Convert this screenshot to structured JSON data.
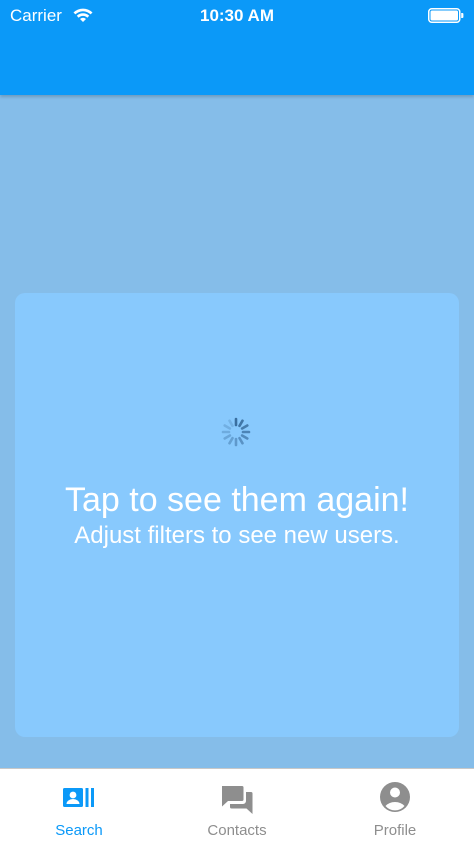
{
  "status_bar": {
    "carrier": "Carrier",
    "time": "10:30 AM",
    "wifi_icon": "wifi-icon",
    "battery_icon": "battery-icon"
  },
  "card": {
    "title": "Tap to see them again!",
    "subtitle": "Adjust filters to see new users.",
    "spinner_icon": "loading-spinner-icon"
  },
  "tabs": [
    {
      "label": "Search",
      "icon": "contact-card-icon",
      "active": true
    },
    {
      "label": "Contacts",
      "icon": "chat-bubbles-icon",
      "active": false
    },
    {
      "label": "Profile",
      "icon": "account-circle-icon",
      "active": false
    }
  ],
  "colors": {
    "header": "#0b99f8",
    "background": "#85bde9",
    "card": "#88c9fd",
    "tab_active": "#0b99f8",
    "tab_inactive": "#8e8e8e"
  }
}
